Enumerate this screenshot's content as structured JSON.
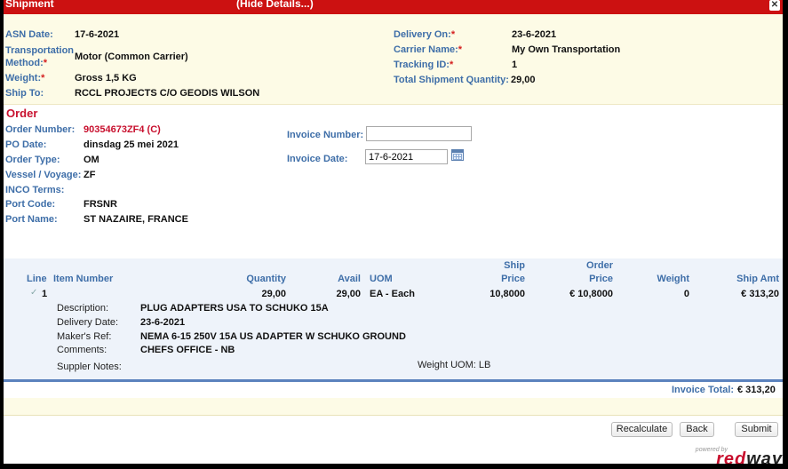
{
  "titlebar": {
    "title": "Shipment",
    "hide_link": "(Hide Details...)",
    "close": "✕"
  },
  "shipment": {
    "asn_date_label": "ASN Date:",
    "asn_date": "17-6-2021",
    "transport_label_1": "Transportation",
    "transport_label_2": "Method:",
    "transport": "Motor (Common Carrier)",
    "weight_label": "Weight:",
    "weight": "Gross  1,5  KG",
    "ship_to_label": "Ship To:",
    "ship_to": "RCCL PROJECTS C/O GEODIS WILSON",
    "delivery_on_label": "Delivery On:",
    "delivery_on": "23-6-2021",
    "carrier_label": "Carrier Name:",
    "carrier": "My Own Transportation",
    "tracking_label": "Tracking ID:",
    "tracking": "1",
    "total_qty_label": "Total Shipment Quantity:",
    "total_qty": "29,00",
    "required_mark": "*"
  },
  "order": {
    "title": "Order",
    "order_number_label": "Order Number:",
    "order_number": "90354673ZF4 (C)",
    "po_date_label": "PO Date:",
    "po_date": "dinsdag 25 mei 2021",
    "order_type_label": "Order Type:",
    "order_type": "OM",
    "vessel_label": "Vessel / Voyage:",
    "vessel": "ZF",
    "inco_label": "INCO Terms:",
    "inco": "",
    "port_code_label": "Port Code:",
    "port_code": "FRSNR",
    "port_name_label": "Port Name:",
    "port_name": "ST NAZAIRE, FRANCE",
    "invoice_number_label": "Invoice Number:",
    "invoice_number": "",
    "invoice_date_label": "Invoice Date:",
    "invoice_date": "17-6-2021"
  },
  "lines": {
    "headers": {
      "line": "Line",
      "item_number": "Item Number",
      "quantity": "Quantity",
      "avail": "Avail",
      "uom": "UOM",
      "ship_price_1": "Ship",
      "ship_price_2": "Price",
      "order_price_1": "Order",
      "order_price_2": "Price",
      "weight": "Weight",
      "ship_amt": "Ship Amt"
    },
    "row": {
      "check": "✓",
      "line": "1",
      "quantity": "29,00",
      "avail": "29,00",
      "uom": "EA - Each",
      "ship_price": "10,8000",
      "order_price": "€ 10,8000",
      "weight": "0",
      "ship_amt": "€ 313,20"
    },
    "details": {
      "description_label": "Description:",
      "description": "PLUG ADAPTERS USA TO SCHUKO 15A",
      "delivery_date_label": "Delivery Date:",
      "delivery_date": "23-6-2021",
      "makers_ref_label": "Maker's Ref:",
      "makers_ref": "NEMA 6-15 250V 15A US ADAPTER W SCHUKO GROUND",
      "comments_label": "Comments:",
      "comments": "CHEFS OFFICE - NB",
      "supplier_notes_label": "Suppler Notes:",
      "weight_uom": "Weight UOM: LB"
    }
  },
  "totals": {
    "invoice_total_label": "Invoice Total:",
    "invoice_total": "€ 313,20"
  },
  "buttons": {
    "recalculate": "Recalculate",
    "back": "Back",
    "submit": "Submit"
  },
  "branding": {
    "powered_by": "powered by",
    "logo_red": "red",
    "logo_dark": "way"
  },
  "colors": {
    "title_red": "#cc1111",
    "label_blue": "#3e6ea8",
    "panel_yellow": "#fdfbe6",
    "table_blue": "#eef3fa"
  }
}
